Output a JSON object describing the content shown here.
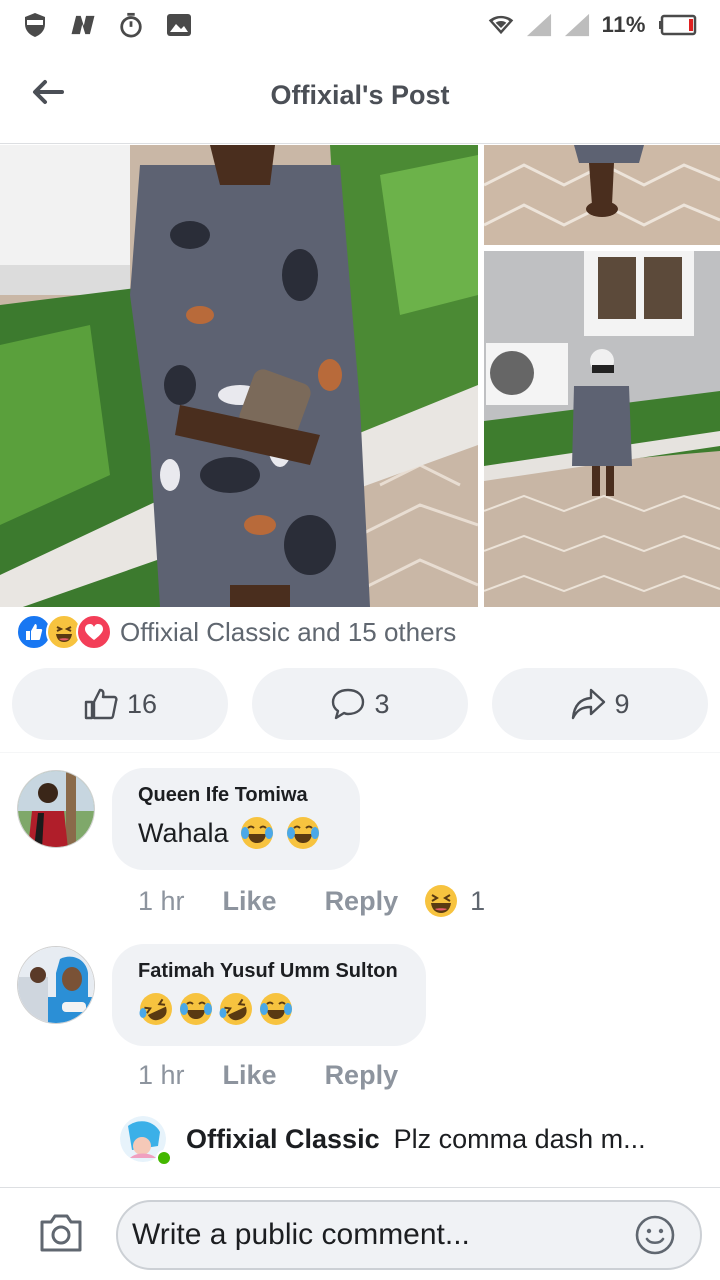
{
  "status_bar": {
    "battery_percent": "11%",
    "icons": [
      "shield-icon",
      "n-app-icon",
      "stopwatch-icon",
      "image-icon",
      "wifi-icon",
      "signal-icon",
      "signal-icon",
      "battery-icon"
    ]
  },
  "header": {
    "title": "Offixial's Post",
    "back_icon": "arrow-left-icon"
  },
  "post": {
    "reactions_summary": "Offixial Classic and 15 others",
    "reaction_icons": [
      "like-icon",
      "haha-icon",
      "love-icon"
    ],
    "actions": {
      "like_count": "16",
      "comment_count": "3",
      "share_count": "9"
    }
  },
  "comments": [
    {
      "author": "Queen Ife Tomiwa",
      "text": "Wahala",
      "time": "1 hr",
      "like_label": "Like",
      "reply_label": "Reply",
      "reaction_count": "1"
    },
    {
      "author": "Fatimah Yusuf Umm Sulton",
      "text": "",
      "time": "1 hr",
      "like_label": "Like",
      "reply_label": "Reply"
    }
  ],
  "reply_preview": {
    "author": "Offixial Classic",
    "text": "Plz comma dash m..."
  },
  "composer": {
    "placeholder": "Write a public comment..."
  },
  "colors": {
    "accent_blue": "#1877f2",
    "love_red": "#f33e58",
    "haha_yellow": "#f7c33f",
    "online_green": "#44b700"
  }
}
